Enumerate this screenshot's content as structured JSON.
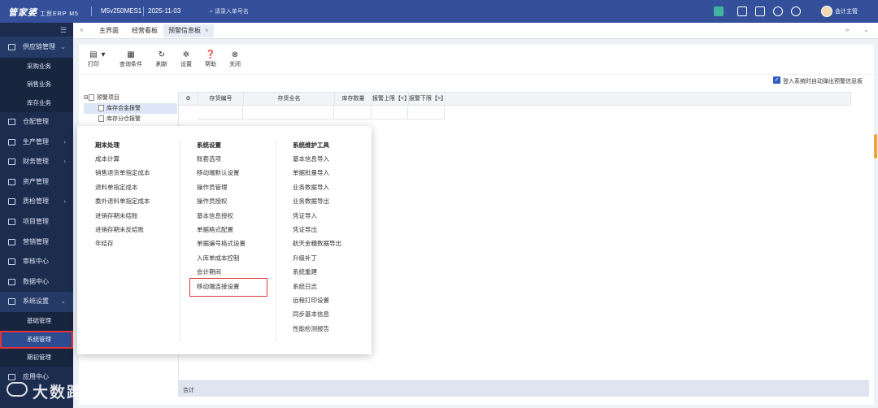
{
  "app": {
    "logo_text": "管家婆",
    "logo_sub": "工贸ERP M5",
    "account": "M5v250MES1",
    "date": "2025-11-03",
    "search_placeholder": "请录入单号名",
    "user": "会计主管"
  },
  "sidebar": {
    "items": [
      {
        "label": "供应链管理",
        "arrow": "⌄"
      },
      {
        "label": "仓配管理",
        "arrow": ""
      },
      {
        "label": "生产管理",
        "arrow": "›"
      },
      {
        "label": "财务管理",
        "arrow": "›"
      },
      {
        "label": "资产管理",
        "arrow": ""
      },
      {
        "label": "质检管理",
        "arrow": "›"
      },
      {
        "label": "项目管理",
        "arrow": ""
      },
      {
        "label": "营销管理",
        "arrow": ""
      },
      {
        "label": "审核中心",
        "arrow": ""
      },
      {
        "label": "数据中心",
        "arrow": ""
      },
      {
        "label": "系统设置",
        "arrow": "⌄"
      },
      {
        "label": "应用中心",
        "arrow": ""
      }
    ],
    "supply_sub": [
      "采购业务",
      "销售业务",
      "库存业务"
    ],
    "system_sub": [
      "基础管理",
      "系统管理",
      "期初管理"
    ]
  },
  "tabs": [
    {
      "label": "主界面"
    },
    {
      "label": "经营看板"
    },
    {
      "label": "预警信息板",
      "close": "×"
    }
  ],
  "toolbar": [
    "打印",
    "查询条件",
    "刷新",
    "设置",
    "帮助",
    "关闭"
  ],
  "auto_popup_label": "登入系统时自动弹出预警信息板",
  "tree": {
    "root": "预警项目",
    "children": [
      "库存合金报警",
      "库存分仓报警"
    ]
  },
  "grid": {
    "headers": [
      "存货编号",
      "存货全名",
      "库存数量",
      "报警上限【<】",
      "报警下限【>】"
    ],
    "footer": "合计"
  },
  "popup": {
    "col1": {
      "head": "期末处理",
      "items": [
        "成本计算",
        "销售退货单指定成本",
        "退料单指定成本",
        "委外退料单指定成本",
        "进销存期末结账",
        "进销存期末反结账",
        "年结存"
      ]
    },
    "col2": {
      "head": "系统设置",
      "items": [
        "账套选项",
        "移动端默认设置",
        "操作员管理",
        "操作员授权",
        "基本信息授权",
        "单据格式配置",
        "单据编号格式设置",
        "入库单成本控制",
        "会计期间",
        "移动端连接设置"
      ]
    },
    "col3": {
      "head": "系统维护工具",
      "items": [
        "基本信息导入",
        "单据批量导入",
        "业务数据导入",
        "业务数据导出",
        "凭证导入",
        "凭证导出",
        "航天金穗数据导出",
        "升级补丁",
        "系统重建",
        "系统日志",
        "远程打印设置",
        "同步基本信息",
        "性能检测报告"
      ]
    }
  },
  "watermark": "大数跨境"
}
